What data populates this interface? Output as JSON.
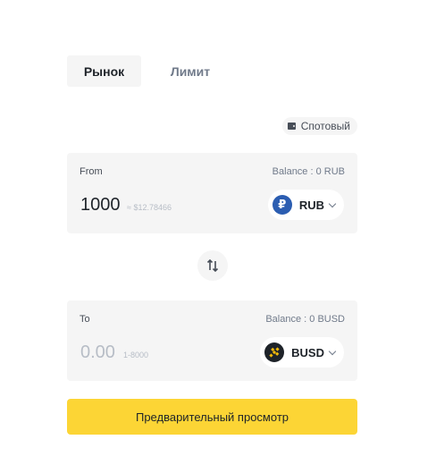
{
  "tabs": [
    {
      "label": "Рынок",
      "active": true
    },
    {
      "label": "Лимит",
      "active": false
    }
  ],
  "wallet_badge": {
    "label": "Спотовый",
    "icon": "wallet-icon"
  },
  "from": {
    "label": "From",
    "balance": "Balance : 0 RUB",
    "amount": "1000",
    "usd_estimate": "≈ $12.78466",
    "coin": "RUB",
    "coin_symbol": "₽"
  },
  "swap": {
    "icon": "swap-arrows-icon"
  },
  "to": {
    "label": "To",
    "balance": "Balance : 0 BUSD",
    "amount_placeholder": "0.00",
    "range": "1-8000",
    "coin": "BUSD"
  },
  "preview_button": {
    "label": "Предварительный просмотр"
  },
  "colors": {
    "accent": "#fcd535",
    "panel_bg": "#f5f5f5",
    "rub_icon": "#2b5db1",
    "busd_icon_bg": "#1e2329",
    "busd_icon_fg": "#f0b90b"
  }
}
